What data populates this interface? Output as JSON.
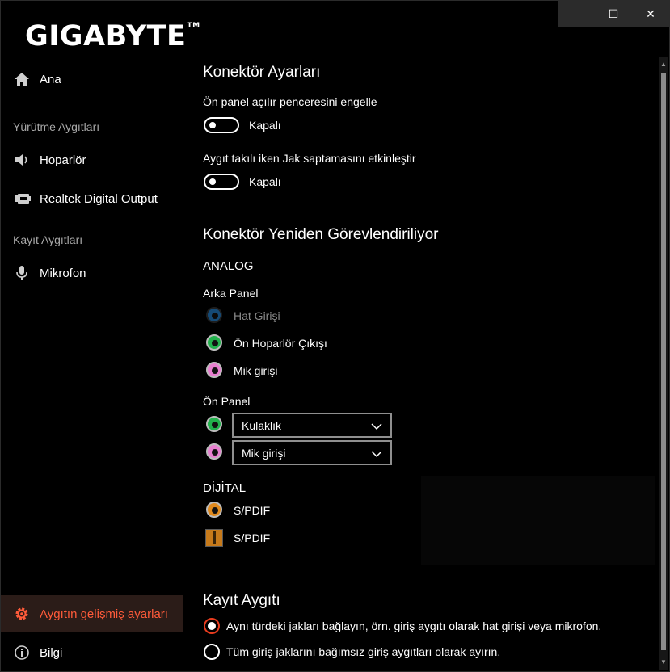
{
  "window": {
    "controls": {
      "minimize": "—",
      "maximize": "☐",
      "close": "✕"
    }
  },
  "logo": {
    "text": "GIGABYTE",
    "tm": "TM"
  },
  "sidebar": {
    "home": "Ana",
    "playback_section": "Yürütme Aygıtları",
    "speaker": "Hoparlör",
    "digital_output": "Realtek Digital Output",
    "record_section": "Kayıt Aygıtları",
    "microphone": "Mikrofon",
    "advanced": "Aygıtın gelişmiş ayarları",
    "info": "Bilgi"
  },
  "connector_settings": {
    "title": "Konektör Ayarları",
    "front_popup_label": "Ön panel açılır penceresini engelle",
    "front_popup_state": "Kapalı",
    "jack_detect_label": "Aygıt takılı iken Jak saptamasını etkinleştir",
    "jack_detect_state": "Kapalı"
  },
  "reassign": {
    "title": "Konektör Yeniden Görevlendiriliyor",
    "analog": "ANALOG",
    "rear_panel": "Arka Panel",
    "rear_jacks": [
      "Hat Girişi",
      "Ön Hoparlör Çıkışı",
      "Mik girişi"
    ],
    "front_panel": "Ön Panel",
    "front_selects": [
      "Kulaklık",
      "Mik girişi"
    ],
    "digital": "DİJİTAL",
    "digital_jacks": [
      "S/PDIF",
      "S/PDIF"
    ]
  },
  "recording_device": {
    "title": "Kayıt Aygıtı",
    "option_same": "Aynı türdeki jakları bağlayın, örn. giriş aygıtı olarak hat girişi veya mikrofon.",
    "option_separate": "Tüm giriş jaklarını bağımsız giriş aygıtları olarak ayırın."
  },
  "colors": {
    "accent": "#e73b1e",
    "jack_blue": "#1f6aa8",
    "jack_green": "#22b24c",
    "jack_pink": "#e87fd0",
    "jack_orange": "#e08a1e"
  }
}
